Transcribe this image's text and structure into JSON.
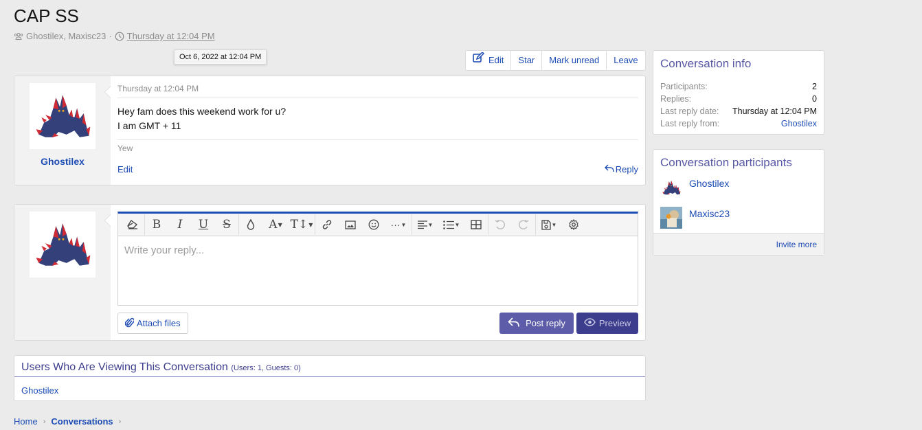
{
  "page": {
    "title": "CAP SS",
    "participants_text": "Ghostilex, Maxisc23",
    "separator": "·",
    "started_time": "Thursday at 12:04 PM",
    "tooltip": "Oct 6, 2022 at 12:04 PM"
  },
  "actions": {
    "edit": "Edit",
    "star": "Star",
    "mark_unread": "Mark unread",
    "leave": "Leave"
  },
  "message": {
    "author": "Ghostilex",
    "date": "Thursday at 12:04 PM",
    "body_lines": [
      "Hey fam does this weekend work for u?",
      "I am GMT + 11"
    ],
    "signature": "Yew",
    "edit_label": "Edit",
    "reply_label": "Reply"
  },
  "editor": {
    "placeholder": "Write your reply...",
    "toolbar": [
      "remove-format",
      "bold",
      "italic",
      "underline",
      "strikethrough",
      "text-color",
      "font-family",
      "font-size",
      "insert-link",
      "insert-image",
      "smilies",
      "more",
      "align",
      "list",
      "table",
      "undo",
      "redo",
      "drafts",
      "settings"
    ],
    "attach_label": "Attach files",
    "post_label": "Post reply",
    "preview_label": "Preview"
  },
  "viewing": {
    "title": "Users Who Are Viewing This Conversation",
    "counts": "(Users: 1, Guests: 0)",
    "users": [
      "Ghostilex"
    ]
  },
  "breadcrumb": [
    {
      "label": "Home"
    },
    {
      "label": "Conversations"
    }
  ],
  "sidebar": {
    "info": {
      "title": "Conversation info",
      "rows": [
        {
          "label": "Participants:",
          "value": "2"
        },
        {
          "label": "Replies:",
          "value": "0"
        },
        {
          "label": "Last reply date:",
          "value": "Thursday at 12:04 PM"
        },
        {
          "label": "Last reply from:",
          "value": "Ghostilex"
        }
      ]
    },
    "participants": {
      "title": "Conversation participants",
      "items": [
        {
          "name": "Ghostilex"
        },
        {
          "name": "Maxisc23"
        }
      ],
      "invite_label": "Invite more"
    }
  },
  "colors": {
    "link": "#1d4cb4",
    "accent": "#5c5ca8",
    "accent_dark": "#3d3d8d",
    "page_bg": "#ebebeb"
  }
}
